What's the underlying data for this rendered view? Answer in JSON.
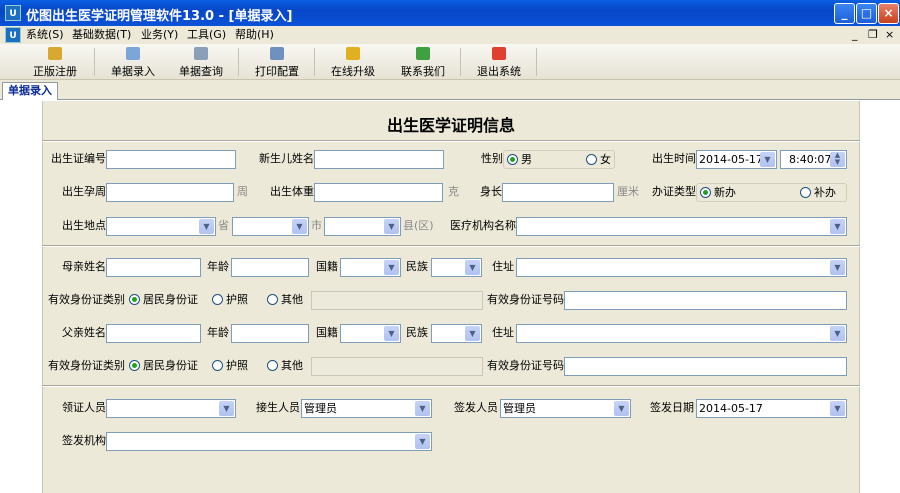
{
  "window": {
    "title": "优图出生医学证明管理软件13.0 - [单据录入]",
    "logo": "U",
    "min": "_",
    "max": "□",
    "close": "×"
  },
  "menu": [
    "系统(S)",
    "基础数据(T)",
    "业务(Y)",
    "工具(G)",
    "帮助(H)"
  ],
  "mdi": {
    "min": "_",
    "restore": "❐",
    "close": "×"
  },
  "toolbar": [
    {
      "label": "正版注册",
      "icon": "lock-icon",
      "color": "#d8a830"
    },
    {
      "label": "单据录入",
      "icon": "edit-icon",
      "color": "#7aa6d8"
    },
    {
      "label": "单据查询",
      "icon": "document-icon",
      "color": "#8aa0b8"
    },
    {
      "label": "打印配置",
      "icon": "list-icon",
      "color": "#7090c0"
    },
    {
      "label": "在线升级",
      "icon": "upgrade-icon",
      "color": "#e0b020"
    },
    {
      "label": "联系我们",
      "icon": "home-icon",
      "color": "#40a040"
    },
    {
      "label": "退出系统",
      "icon": "exit-icon",
      "color": "#e04030"
    }
  ],
  "tab": "单据录入",
  "form": {
    "heading": "出生医学证明信息",
    "cert_no": "出生证编号",
    "baby_name": "新生儿姓名",
    "gender": "性别",
    "male": "男",
    "female": "女",
    "birth_time": "出生时间",
    "birth_date_value": "2014-05-17",
    "birth_time_value": "8:40:07",
    "gest_weeks": "出生孕周",
    "weeks_unit": "周",
    "weight": "出生体重",
    "weight_unit": "克",
    "length": "身长",
    "length_unit": "厘米",
    "cert_type": "办证类型",
    "new": "新办",
    "reissue": "补办",
    "birthplace": "出生地点",
    "province": "省",
    "city": "市",
    "county": "县(区)",
    "hospital": "医疗机构名称",
    "mother_name": "母亲姓名",
    "father_name": "父亲姓名",
    "age": "年龄",
    "nationality": "国籍",
    "ethnicity": "民族",
    "address": "住址",
    "id_type": "有效身份证类别",
    "id_card": "居民身份证",
    "passport": "护照",
    "other": "其他",
    "id_no": "有效身份证号码",
    "receiver": "领证人员",
    "deliverer": "接生人员",
    "deliverer_value": "管理员",
    "issuer": "签发人员",
    "issuer_value": "管理员",
    "issue_date": "签发日期",
    "issue_date_value": "2014-05-17",
    "issue_org": "签发机构"
  }
}
